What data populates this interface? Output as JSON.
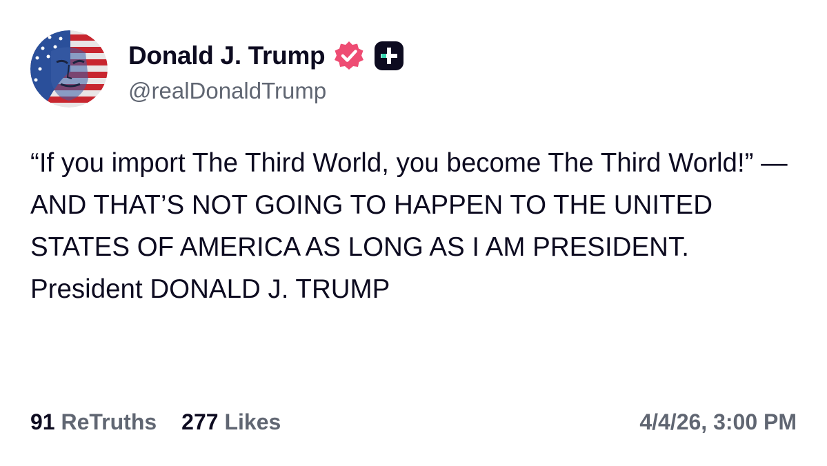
{
  "post": {
    "author": {
      "display_name": "Donald J. Trump",
      "handle": "@realDonaldTrump",
      "avatar": "flag-portrait-avatar",
      "badges": [
        "verified-badge-icon",
        "truth-social-plus-icon"
      ]
    },
    "text": "“If you import The Third World, you become The Third World!” — AND THAT’S NOT GOING TO HAPPEN TO THE UNITED STATES OF AMERICA AS LONG AS I AM PRESIDENT. President DONALD J. TRUMP",
    "stats": {
      "retruths_count": "91",
      "retruths_label": "ReTruths",
      "likes_count": "277",
      "likes_label": "Likes"
    },
    "timestamp": "4/4/26, 3:00 PM"
  },
  "colors": {
    "text": "#0d0b20",
    "muted": "#606672",
    "verified": "#ee4c73",
    "plus_bg": "#0d0b20",
    "plus_accent": "#38d6b0"
  }
}
